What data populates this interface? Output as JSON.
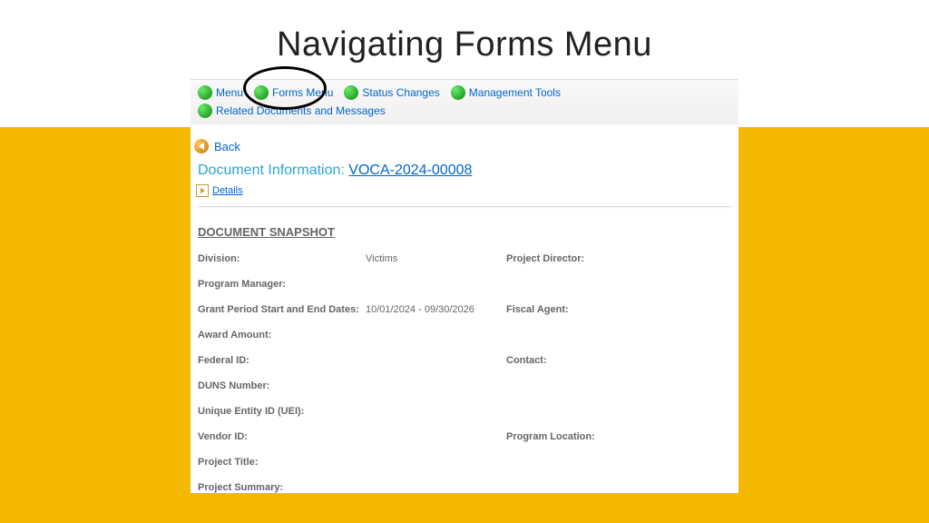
{
  "title": "Navigating Forms Menu",
  "nav": {
    "items": [
      {
        "label": "Menu"
      },
      {
        "label": "Forms Menu"
      },
      {
        "label": "Status Changes"
      },
      {
        "label": "Management Tools"
      },
      {
        "label": "Related Documents and Messages"
      }
    ]
  },
  "back": {
    "label": "Back"
  },
  "docInfo": {
    "label": "Document Information: ",
    "link": "VOCA-2024-00008"
  },
  "details": {
    "label": "Details"
  },
  "snapshot": {
    "title": "DOCUMENT SNAPSHOT",
    "rows": {
      "division": {
        "label": "Division:",
        "value": "Victims"
      },
      "projectDirector": {
        "label": "Project Director:",
        "value": ""
      },
      "programManager": {
        "label": "Program Manager:",
        "value": ""
      },
      "grantPeriod": {
        "label": "Grant Period Start and End Dates:",
        "value": "10/01/2024 - 09/30/2026"
      },
      "fiscalAgent": {
        "label": "Fiscal Agent:",
        "value": ""
      },
      "awardAmount": {
        "label": "Award Amount:",
        "value": ""
      },
      "federalId": {
        "label": "Federal ID:",
        "value": ""
      },
      "contact": {
        "label": "Contact:",
        "value": ""
      },
      "dunsNumber": {
        "label": "DUNS Number:",
        "value": ""
      },
      "uei": {
        "label": "Unique Entity ID (UEI):",
        "value": ""
      },
      "vendorId": {
        "label": "Vendor ID:",
        "value": ""
      },
      "programLocation": {
        "label": "Program Location:",
        "value": ""
      },
      "projectTitle": {
        "label": "Project Title:",
        "value": ""
      },
      "projectSummary": {
        "label": "Project Summary:",
        "value": ""
      }
    }
  }
}
